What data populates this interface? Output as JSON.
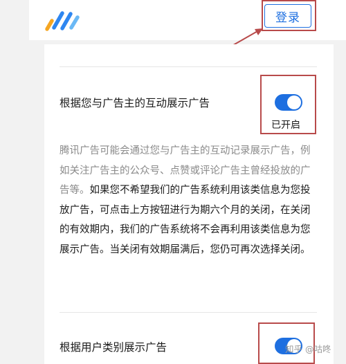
{
  "header": {
    "login_label": "登录",
    "brand_colors": [
      "#2e86f0",
      "#f5a623",
      "#6ab8f5"
    ]
  },
  "settings": [
    {
      "label": "根据您与广告主的互动展示广告",
      "enabled": true,
      "status_text": "已开启"
    },
    {
      "label": "根据用户类别展示广告",
      "enabled": true
    }
  ],
  "description": {
    "muted_part": "腾讯广告可能会通过您与广告主的互动记录展示广告，例如关注广告主的公众号、点赞或评论广告主曾经投放的广告等。",
    "main_part": "如果您不希望我们的广告系统利用该类信息为您投放广告，可点击上方按钮进行为期六个月的关闭，在关闭的有效期内，我们的广告系统将不会再利用该类信息为您展示广告。当关闭有效期届满后，您仍可再次选择关闭。"
  },
  "watermark": "知乎 @咕咚",
  "colors": {
    "accent": "#1e6fe0",
    "annotation": "#b84a4a"
  }
}
